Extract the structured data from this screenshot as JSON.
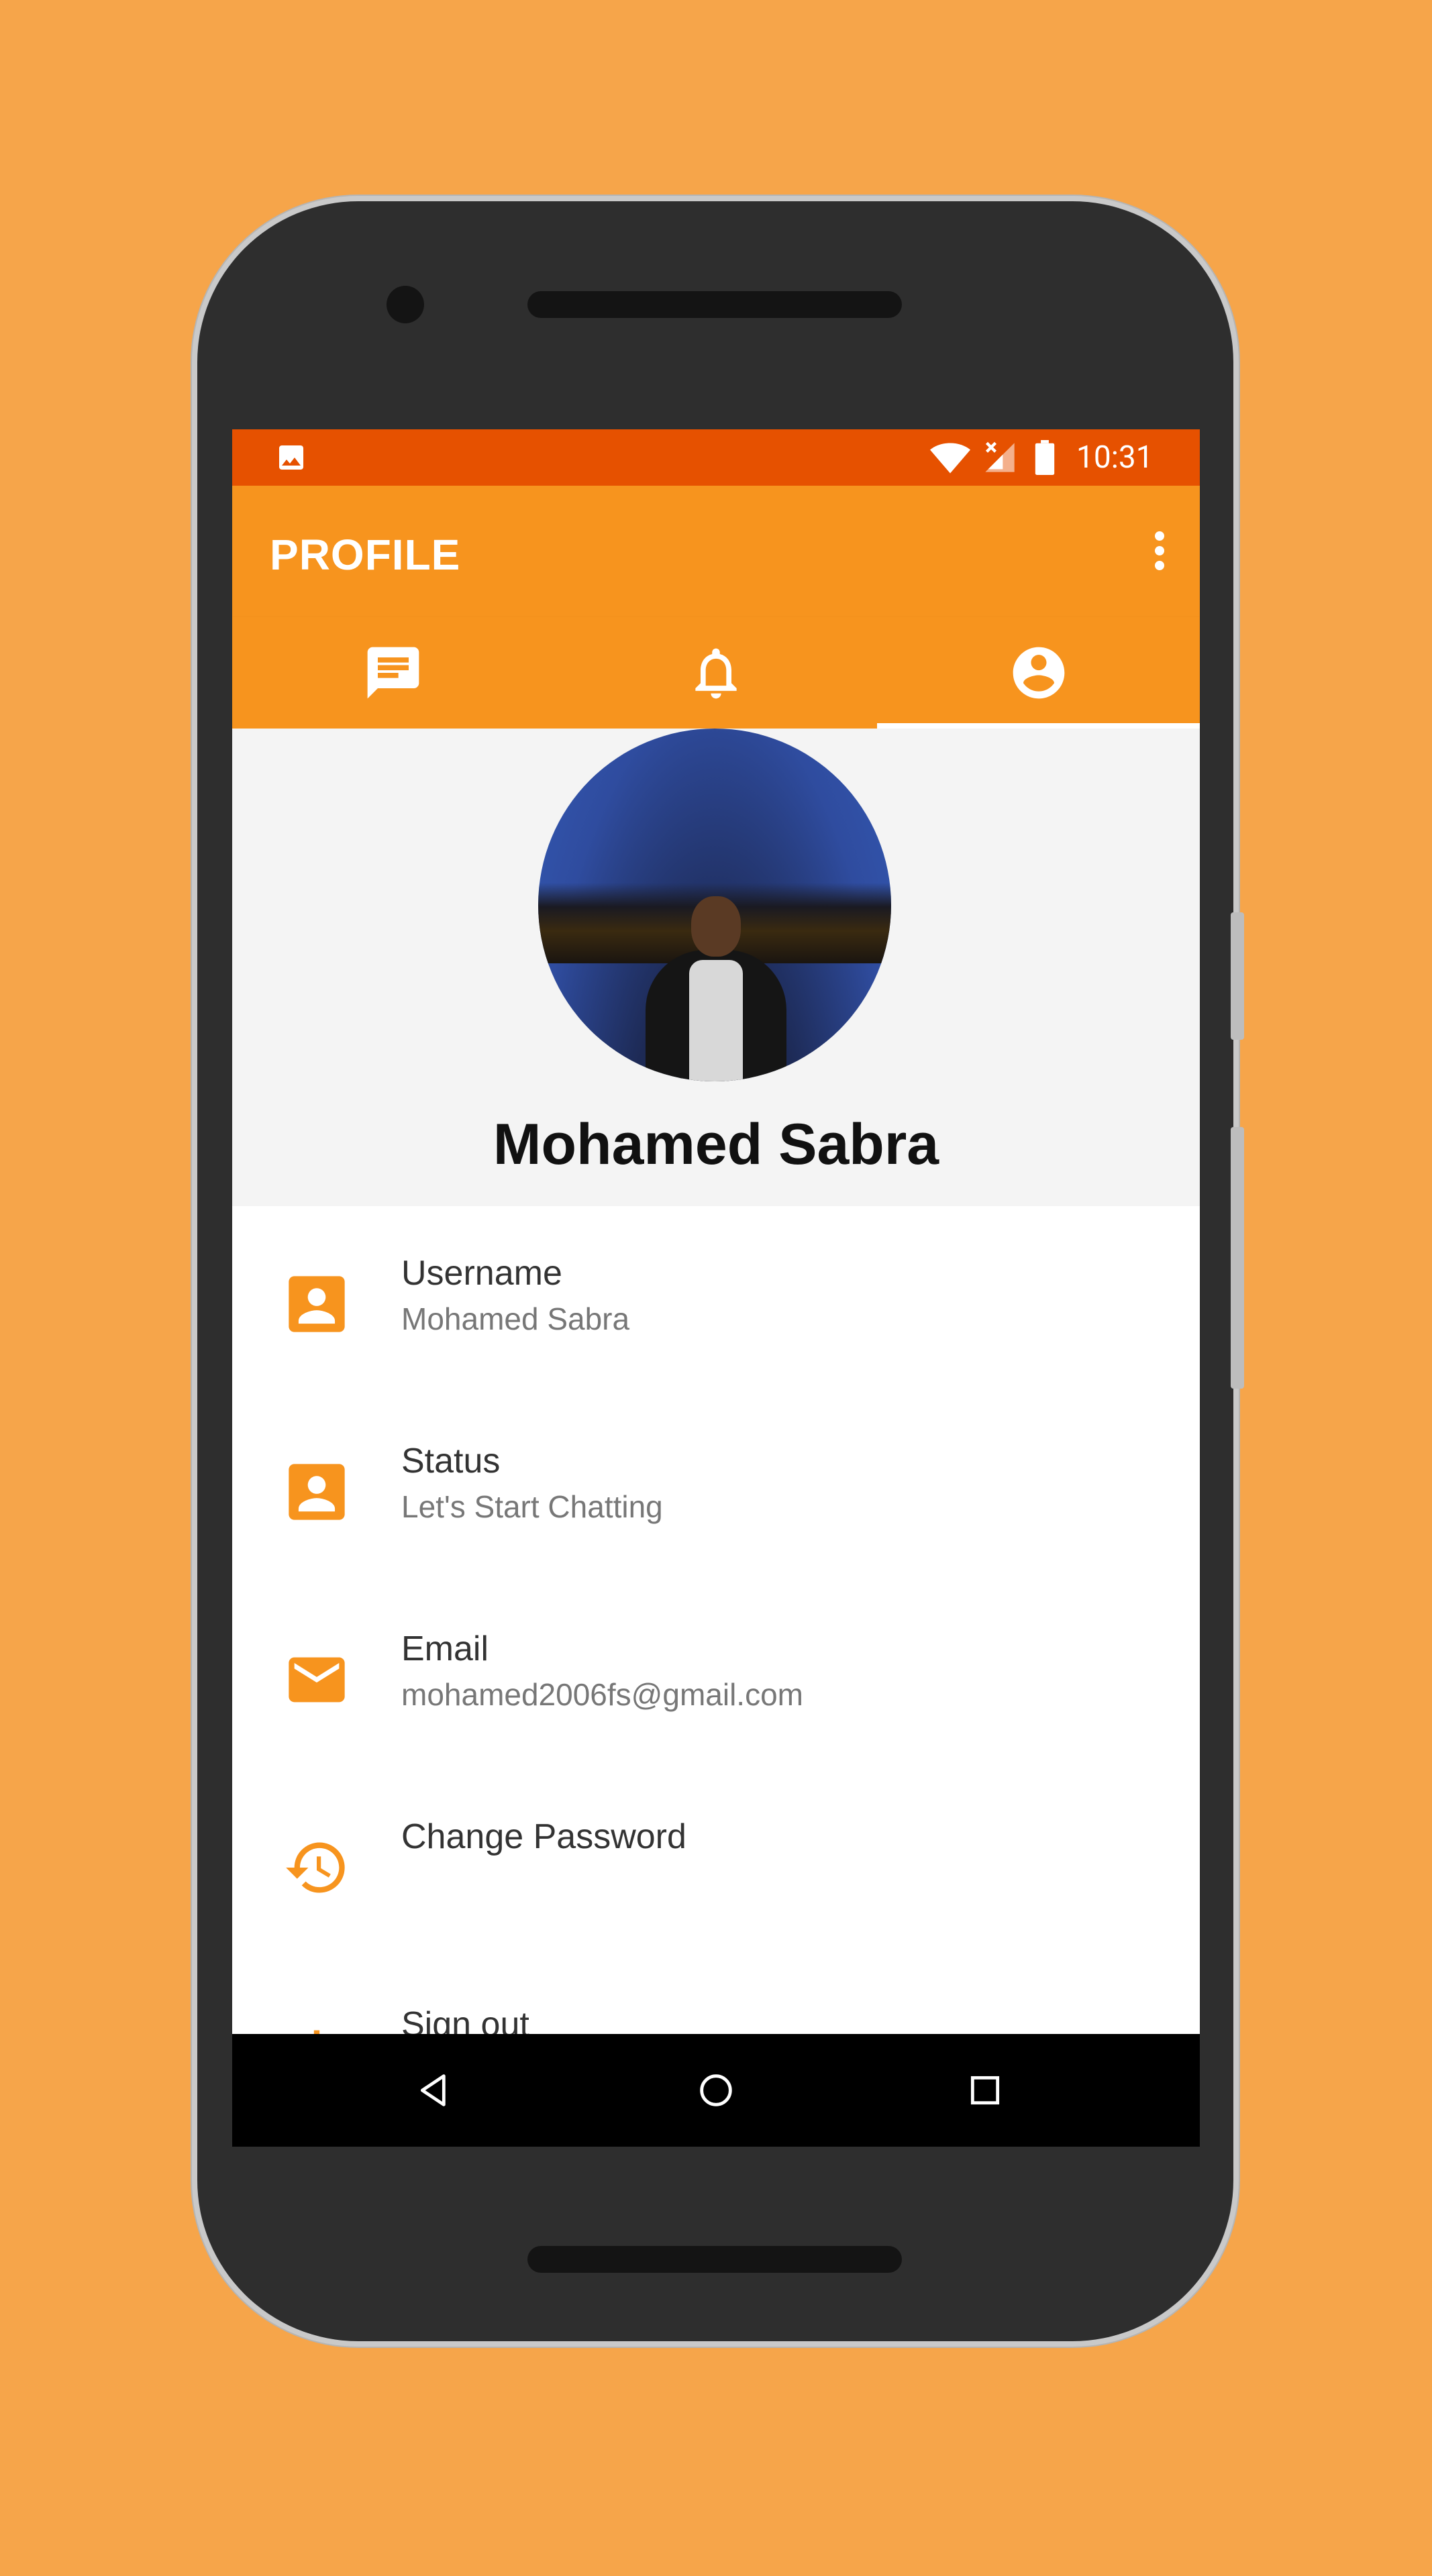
{
  "status_bar": {
    "time": "10:31",
    "icons": [
      "image-icon",
      "wifi-icon",
      "signal-icon",
      "battery-icon"
    ]
  },
  "app_bar": {
    "title": "PROFILE",
    "menu_icon": "more-vert-icon"
  },
  "tabs": [
    {
      "icon": "chat-icon",
      "active": false
    },
    {
      "icon": "bell-icon",
      "active": false
    },
    {
      "icon": "account-circle-icon",
      "active": true
    }
  ],
  "profile": {
    "name": "Mohamed Sabra"
  },
  "info": [
    {
      "icon": "contact-icon",
      "label": "Username",
      "value": "Mohamed Sabra"
    },
    {
      "icon": "contact-icon",
      "label": "Status",
      "value": "Let's Start Chatting"
    },
    {
      "icon": "mail-icon",
      "label": "Email",
      "value": "mohamed2006fs@gmail.com"
    },
    {
      "icon": "history-icon",
      "label": "Change Password",
      "value": ""
    },
    {
      "icon": "power-icon",
      "label": "Sign out",
      "value": ""
    }
  ],
  "navigation": [
    "back-icon",
    "home-icon",
    "recents-icon"
  ],
  "colors": {
    "background": "#F6A54A",
    "status_bar": "#E65100",
    "primary": "#F7941E",
    "header_bg": "#F4F4F4"
  }
}
